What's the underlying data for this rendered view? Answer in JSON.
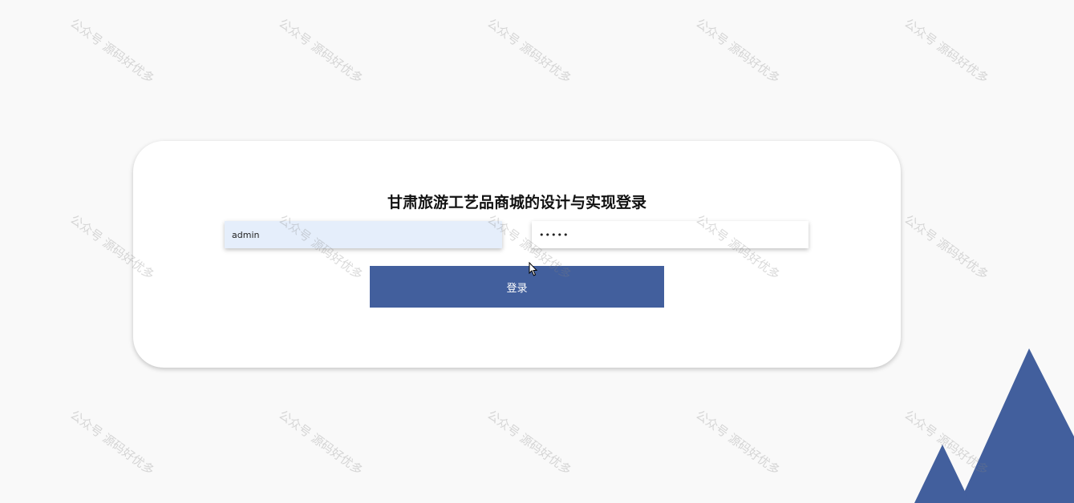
{
  "login": {
    "title": "甘肃旅游工艺品商城的设计与实现登录",
    "username_value": "admin",
    "password_value": "•••••",
    "submit_label": "登录"
  },
  "watermark": {
    "text": "公众号 源码好优多"
  },
  "colors": {
    "accent": "#425f9d",
    "background": "#f9f9f9",
    "card": "#ffffff",
    "username_field_bg": "#e5eefb"
  }
}
